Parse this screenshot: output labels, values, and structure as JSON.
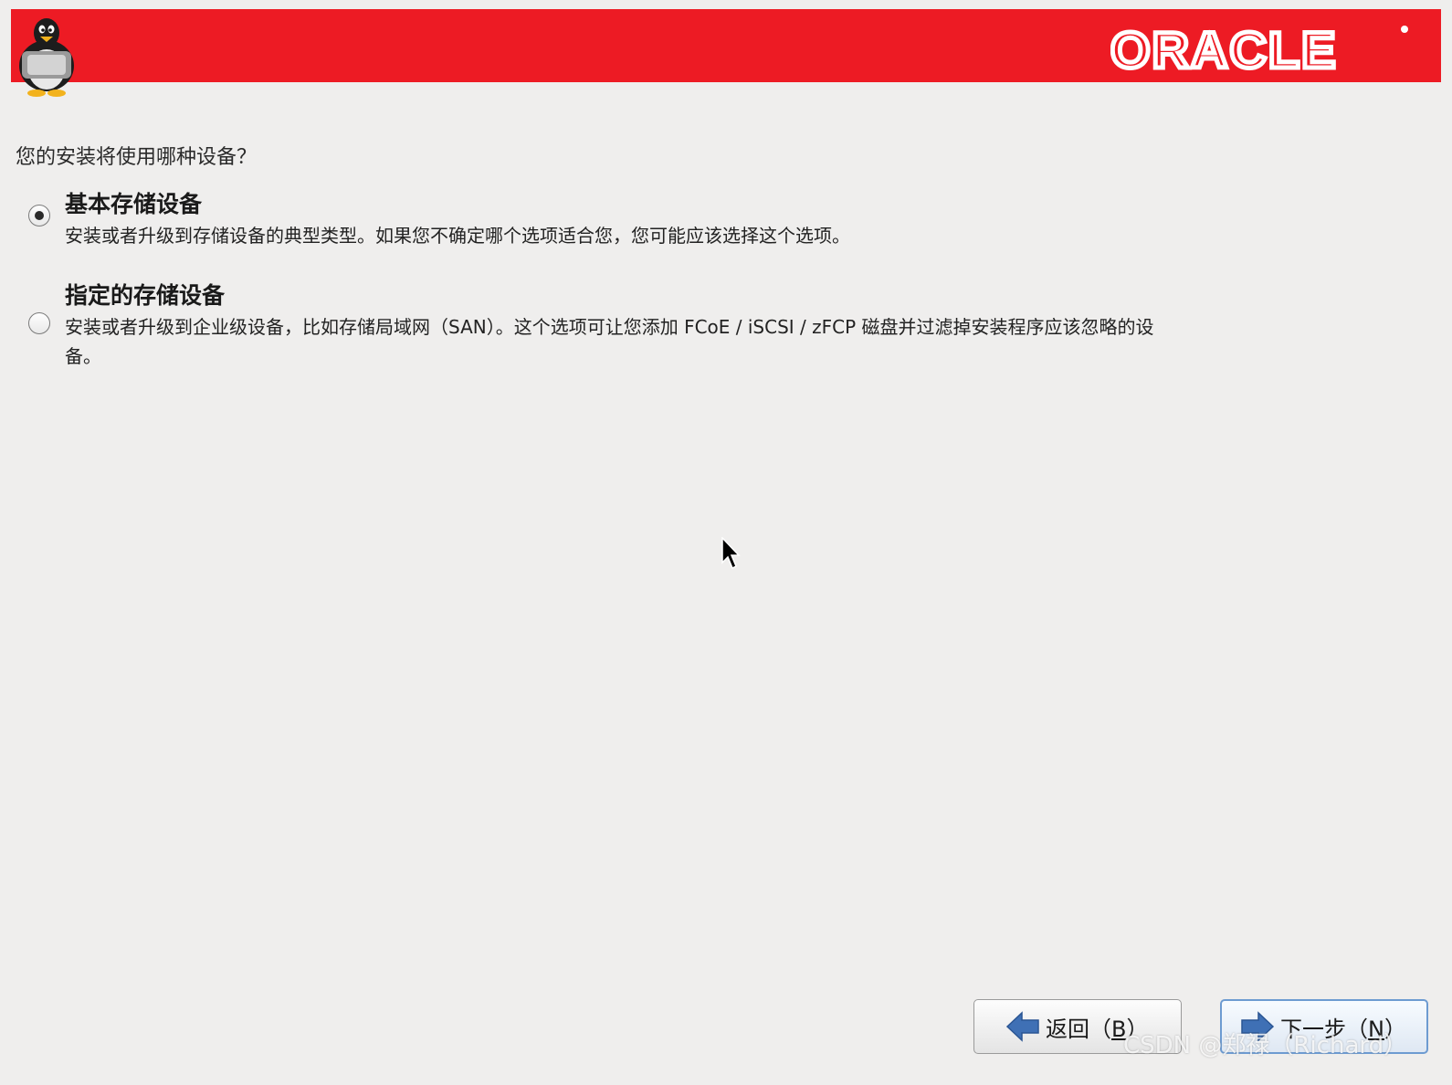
{
  "header": {
    "logo_text": "ORACLE",
    "brand_color": "#ed1b24"
  },
  "question": "您的安装将使用哪种设备？",
  "options": [
    {
      "title": "基本存储设备",
      "description": "安装或者升级到存储设备的典型类型。如果您不确定哪个选项适合您，您可能应该选择这个选项。",
      "selected": true
    },
    {
      "title": "指定的存储设备",
      "description": "安装或者升级到企业级设备，比如存储局域网（SAN）。这个选项可让您添加 FCoE / iSCSI / zFCP 磁盘并过滤掉安装程序应该忽略的设备。",
      "selected": false
    }
  ],
  "buttons": {
    "back": {
      "label_prefix": "返回（",
      "mnemonic": "B",
      "label_suffix": "）",
      "icon": "arrow-left-icon"
    },
    "next": {
      "label_prefix": "下一步（",
      "mnemonic": "N",
      "label_suffix": "）",
      "icon": "arrow-right-icon"
    }
  },
  "watermark": "CSDN @郑禄（Richard）"
}
